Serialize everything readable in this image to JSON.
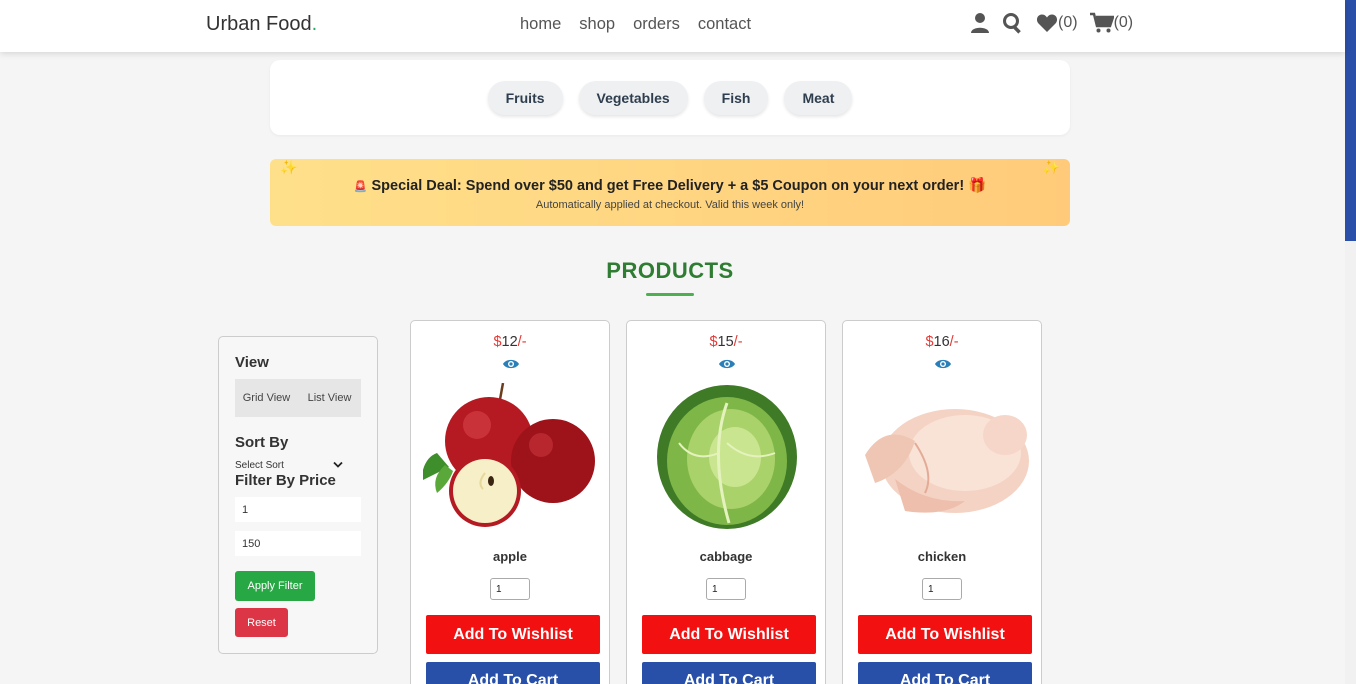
{
  "header": {
    "logo": "Urban Food",
    "logo_dot": ".",
    "nav": [
      "home",
      "shop",
      "orders",
      "contact"
    ],
    "wishlist_count": "(0)",
    "cart_count": "(0)"
  },
  "categories": [
    "Fruits",
    "Vegetables",
    "Fish",
    "Meat"
  ],
  "deal": {
    "siren": "🚨",
    "main": "Special Deal: Spend over $50 and get Free Delivery + a $5 Coupon on your next order!",
    "gift": "🎁",
    "sub": "Automatically applied at checkout. Valid this week only!",
    "sparkle": "✨"
  },
  "products_title": "PRODUCTS",
  "sidebar": {
    "view_heading": "View",
    "grid_view": "Grid View",
    "list_view": "List View",
    "sort_heading": "Sort By",
    "sort_value": "Select Sort",
    "filter_heading": "Filter By Price",
    "min_price": "1",
    "max_price": "150",
    "apply_label": "Apply Filter",
    "reset_label": "Reset"
  },
  "products": [
    {
      "currency": "$",
      "price": "12",
      "suffix": "/-",
      "name": "apple",
      "qty": "1",
      "wishlist_label": "Add To Wishlist",
      "cart_label": "Add To Cart"
    },
    {
      "currency": "$",
      "price": "15",
      "suffix": "/-",
      "name": "cabbage",
      "qty": "1",
      "wishlist_label": "Add To Wishlist",
      "cart_label": "Add To Cart"
    },
    {
      "currency": "$",
      "price": "16",
      "suffix": "/-",
      "name": "chicken",
      "qty": "1",
      "wishlist_label": "Add To Wishlist",
      "cart_label": "Add To Cart"
    }
  ],
  "colors": {
    "accent_green": "#2e7d32",
    "wishlist_red": "#f31010",
    "cart_blue": "#2850a8"
  }
}
